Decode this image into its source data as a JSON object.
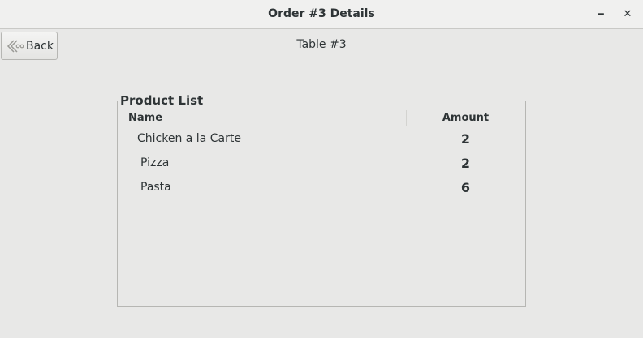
{
  "window": {
    "title": "Order #3 Details",
    "minimize_label": "‒",
    "close_label": "✕"
  },
  "toolbar": {
    "back_label": "Back",
    "back_icon": "back-arrow-icon"
  },
  "header": {
    "table_label": "Table #3"
  },
  "product_list": {
    "title": "Product List",
    "columns": [
      "Name",
      "Amount"
    ],
    "rows": [
      {
        "name": "Chicken a la Carte",
        "amount": "2"
      },
      {
        "name": "Pizza",
        "amount": "2"
      },
      {
        "name": "Pasta",
        "amount": "6"
      }
    ]
  }
}
